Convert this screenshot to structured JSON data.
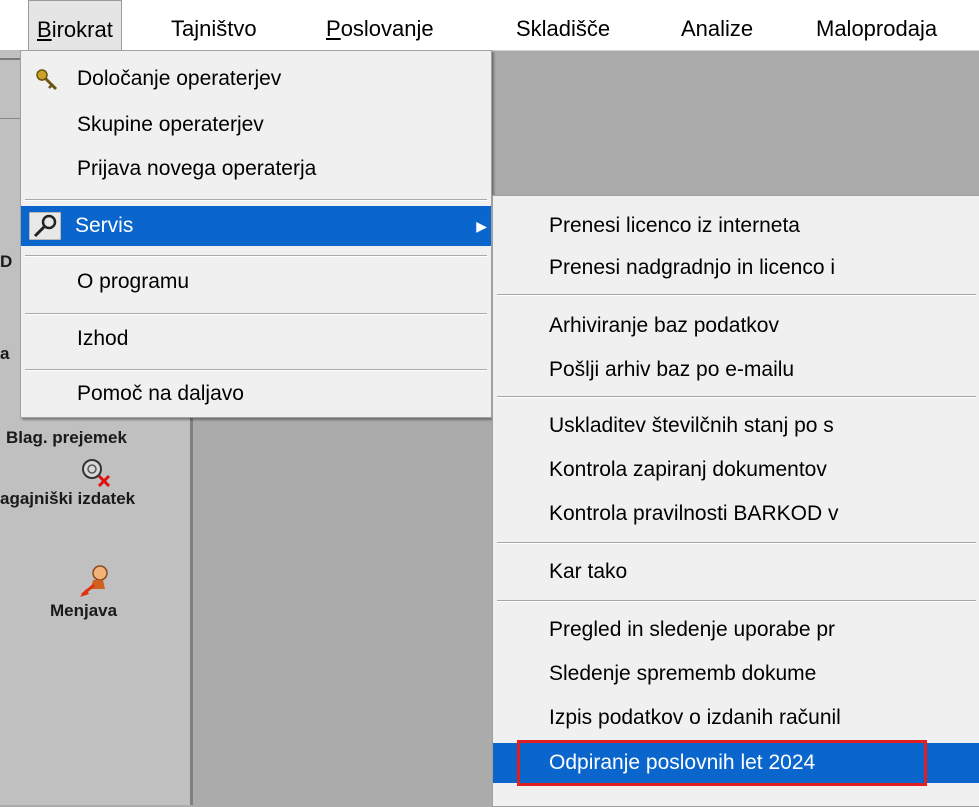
{
  "menubar": {
    "items": [
      {
        "label": "Birokrat",
        "mnemonic_first": "B",
        "rest": "irokrat"
      },
      {
        "label": "Tajništvo"
      },
      {
        "label": "Poslovanje",
        "mnemonic_first": "P",
        "rest": "oslovanje"
      },
      {
        "label": "Skladišče"
      },
      {
        "label": "Analize"
      },
      {
        "label": "Maloprodaja"
      }
    ]
  },
  "main_menu": {
    "items": [
      {
        "label": "Določanje operaterjev",
        "icon": "key-icon"
      },
      {
        "label": "Skupine operaterjev"
      },
      {
        "label": "Prijava novega operaterja"
      },
      {
        "label": "Servis",
        "icon": "wrench-icon",
        "has_submenu": true,
        "selected": true
      },
      {
        "label": "O programu"
      },
      {
        "label": "Izhod"
      },
      {
        "label": "Pomoč na daljavo"
      }
    ]
  },
  "submenu": {
    "items": [
      {
        "label": "Prenesi licenco iz interneta"
      },
      {
        "label": "Prenesi nadgradnjo in licenco i"
      },
      {
        "label": "Arhiviranje baz podatkov"
      },
      {
        "label": "Pošlji arhiv baz po e-mailu"
      },
      {
        "label": "Uskladitev številčnih stanj po s"
      },
      {
        "label": "Kontrola zapiranj dokumentov"
      },
      {
        "label": "Kontrola pravilnosti BARKOD v"
      },
      {
        "label": "Kar tako"
      },
      {
        "label": "Pregled in sledenje uporabe pr"
      },
      {
        "label": "Sledenje sprememb dokume"
      },
      {
        "label": "Izpis podatkov o izdanih računil"
      },
      {
        "label": "Odpiranje poslovnih let 2024",
        "selected": true
      }
    ]
  },
  "toolbar": {
    "partial_1": "D",
    "partial_2": "a",
    "blag_prejemek": "Blag. prejemek",
    "blag_izdatek": "agajniški izdatek",
    "menjava": "Menjava"
  },
  "colors": {
    "selection": "#0a66cc",
    "highlight_border": "#e02020",
    "menu_bg": "#f0f0f0"
  }
}
